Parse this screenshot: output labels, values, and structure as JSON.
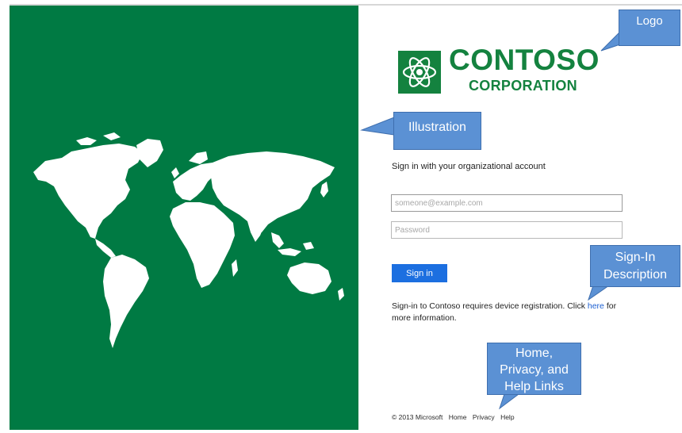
{
  "illustration": {
    "icon": "world-map",
    "background": "#007a43"
  },
  "logo": {
    "title": "CONTOSO",
    "subtitle": "CORPORATION",
    "icon": "atom-icon",
    "color": "#14823f"
  },
  "signin": {
    "description": "Sign in with your organizational account",
    "email_placeholder": "someone@example.com",
    "password_placeholder": "Password",
    "button_label": "Sign in",
    "button_color": "#1c6fe0"
  },
  "registration": {
    "text_before": "Sign-in to Contoso requires device registration. Click",
    "link_text": "here",
    "text_after": "for more information."
  },
  "footer": {
    "copyright": "© 2013 Microsoft",
    "links": [
      "Home",
      "Privacy",
      "Help"
    ]
  },
  "annotations": {
    "logo": "Logo",
    "illustration": "Illustration",
    "signin_line1": "Sign-In",
    "signin_line2": "Description",
    "links_line1": "Home,",
    "links_line2": "Privacy, and",
    "links_line3": "Help Links",
    "color": "#5b91d4"
  }
}
